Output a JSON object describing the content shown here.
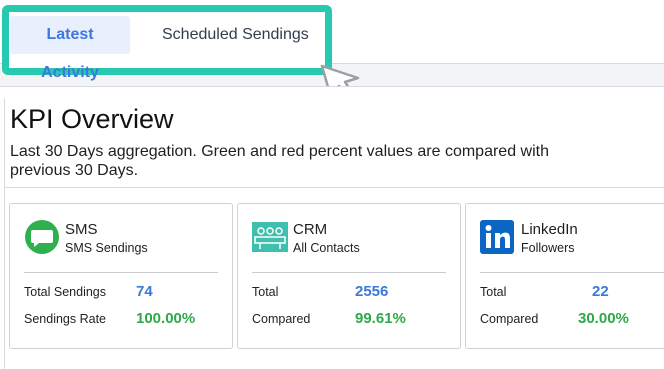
{
  "tabs": [
    {
      "label": "Latest Activity",
      "active": true
    },
    {
      "label": "Scheduled Sendings",
      "active": false
    }
  ],
  "kpi": {
    "title": "KPI Overview",
    "subtitle": "Last 30 Days aggregation. Green and red percent values are compared with previous 30 Days."
  },
  "cards": [
    {
      "icon": "chat-bubble-icon",
      "title": "SMS",
      "subtitle": "SMS Sendings",
      "rows": [
        {
          "label": "Total Sendings",
          "value": "74",
          "color": "#3b78d8"
        },
        {
          "label": "Sendings Rate",
          "value": "100.00%",
          "color": "#2ea84a"
        }
      ]
    },
    {
      "icon": "crm-contacts-icon",
      "title": "CRM",
      "subtitle": "All Contacts",
      "rows": [
        {
          "label": "Total",
          "value": "2556",
          "color": "#3b78d8"
        },
        {
          "label": "Compared",
          "value": "99.61%",
          "color": "#2ea84a"
        }
      ]
    },
    {
      "icon": "linkedin-icon",
      "title": "LinkedIn",
      "subtitle": "Followers",
      "rows": [
        {
          "label": "Total",
          "value": "22",
          "color": "#3b78d8"
        },
        {
          "label": "Compared",
          "value": "30.00%",
          "color": "#2ea84a"
        }
      ]
    }
  ],
  "colors": {
    "highlight": "#27c9b0",
    "accent_blue": "#3b78d8",
    "positive_green": "#2ea84a"
  }
}
